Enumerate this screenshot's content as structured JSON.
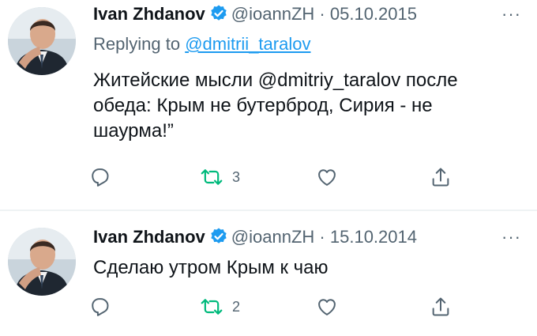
{
  "colors": {
    "text": "#0f1419",
    "secondary": "#536471",
    "link": "#1d9bf0",
    "retweet_green": "#00ba7c",
    "divider": "#eff3f4"
  },
  "icons": [
    "verified-badge-icon",
    "more-dots-icon",
    "reply-icon",
    "retweet-icon",
    "like-icon",
    "share-icon"
  ],
  "tweets": [
    {
      "author": "Ivan Zhdanov",
      "handle": "@ioannZH",
      "separator": "·",
      "date": "05.10.2015",
      "more": "···",
      "replying_prefix": "Replying to",
      "replying_to": "@dmitrii_taralov",
      "text": "Житейские мысли @dmitriy_taralov после обеда:  Крым не бутерброд, Сирия - не шаурма!”",
      "retweets": "3"
    },
    {
      "author": "Ivan Zhdanov",
      "handle": "@ioannZH",
      "separator": "·",
      "date": "15.10.2014",
      "more": "···",
      "text": "Сделаю утром Крым к чаю",
      "retweets": "2"
    }
  ]
}
